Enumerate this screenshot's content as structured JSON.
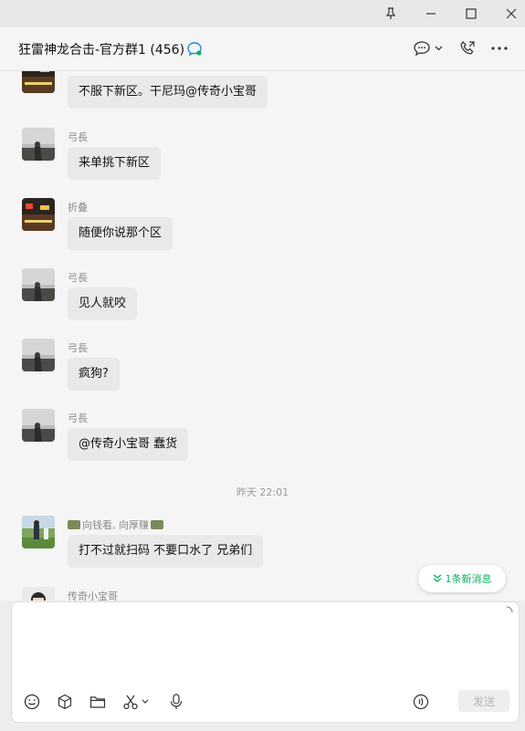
{
  "window": {
    "title": "狂雷神龙合击-官方群1 (456)"
  },
  "header": {
    "chat_title": "狂雷神龙合击-官方群1 (456)"
  },
  "messages": [
    {
      "sender": "",
      "text": "不服下新区。干尼玛@传奇小宝哥"
    },
    {
      "sender": "弓長",
      "text": "来单挑下新区"
    },
    {
      "sender": "折叠",
      "text": "随便你说那个区"
    },
    {
      "sender": "弓長",
      "text": "见人就咬"
    },
    {
      "sender": "弓長",
      "text": "疯狗?"
    },
    {
      "sender": "弓長",
      "text": "@传奇小宝哥 蠢货"
    },
    {
      "sender": "向钱看, 向厚赚",
      "text": "打不过就扫码 不要口水了 兄弟们"
    },
    {
      "sender": "传奇小宝哥",
      "text": ""
    }
  ],
  "time_separator": "昨天 22:01",
  "new_message_badge": "1条新消息",
  "composer": {
    "send_label": "发送"
  },
  "colors": {
    "accent": "#07b35b",
    "bubble": "#e9e9e9",
    "background": "#f5f5f5"
  },
  "icons": [
    "pin-icon",
    "minimize-icon",
    "maximize-icon",
    "close-icon",
    "chat-bubble-icon",
    "chevron-down-icon",
    "call-icon",
    "more-icon",
    "emoji-icon",
    "box-icon",
    "folder-icon",
    "scissors-icon",
    "microphone-icon",
    "voice-input-icon"
  ]
}
